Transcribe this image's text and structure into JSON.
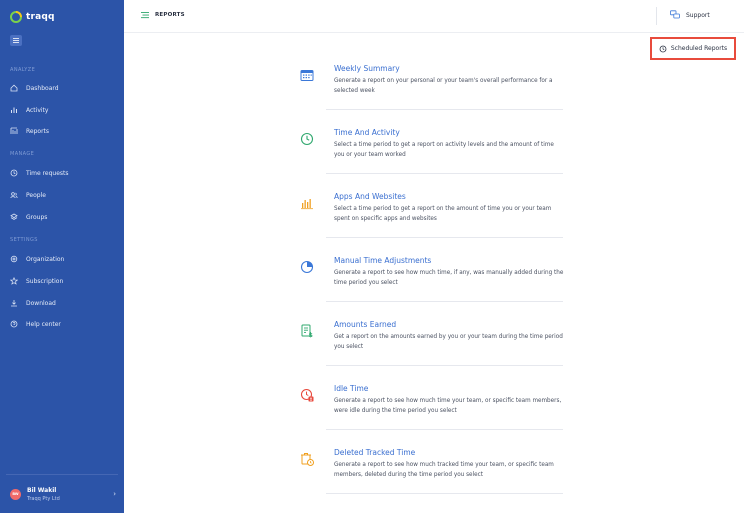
{
  "app": {
    "logo_text": "traqq"
  },
  "sidebar": {
    "sections": [
      {
        "label": "ANALYZE"
      },
      {
        "label": "MANAGE"
      },
      {
        "label": "SETTINGS"
      }
    ],
    "items": [
      {
        "label": "Dashboard"
      },
      {
        "label": "Activity"
      },
      {
        "label": "Reports"
      },
      {
        "label": "Time requests"
      },
      {
        "label": "People"
      },
      {
        "label": "Groups"
      },
      {
        "label": "Organization"
      },
      {
        "label": "Subscription"
      },
      {
        "label": "Download"
      },
      {
        "label": "Help center"
      }
    ],
    "profile": {
      "initials": "BW",
      "name": "Bil Wakil",
      "org": "Traqq Pty Ltd"
    }
  },
  "header": {
    "title": "REPORTS",
    "support_label": "Support"
  },
  "scheduled_reports_label": "Scheduled Reports",
  "reports": [
    {
      "title": "Weekly Summary",
      "description": "Generate a report on your personal or your team's overall performance for a selected week",
      "icon": "calendar-icon"
    },
    {
      "title": "Time And Activity",
      "description": "Select a time period to get a report on activity levels and the amount of time you or your team worked",
      "icon": "clock-icon"
    },
    {
      "title": "Apps And Websites",
      "description": "Select a time period to get a report on the amount of time you or your team spent on specific apps and websites",
      "icon": "bar-chart-icon"
    },
    {
      "title": "Manual Time Adjustments",
      "description": "Generate a report to see how much time, if any, was manually added during the time period you select",
      "icon": "pie-chart-icon"
    },
    {
      "title": "Amounts Earned",
      "description": "Get a report on the amounts earned by you or your team during the time period you select",
      "icon": "dollar-document-icon"
    },
    {
      "title": "Idle Time",
      "description": "Generate a report to see how much time your team, or specific team members, were idle during the time period you select",
      "icon": "idle-clock-icon"
    },
    {
      "title": "Deleted Tracked Time",
      "description": "Generate a report to see how much tracked time your team, or specific team members, deleted during the time period you select",
      "icon": "deleted-time-icon"
    }
  ],
  "colors": {
    "sidebar_bg": "#2c54a8",
    "accent": "#3a6fd0",
    "highlight_border": "#e84b3c",
    "icon_blue": "#3b78d8",
    "icon_green": "#2fa86e",
    "icon_orange": "#f0a020",
    "icon_red": "#e8493d"
  }
}
